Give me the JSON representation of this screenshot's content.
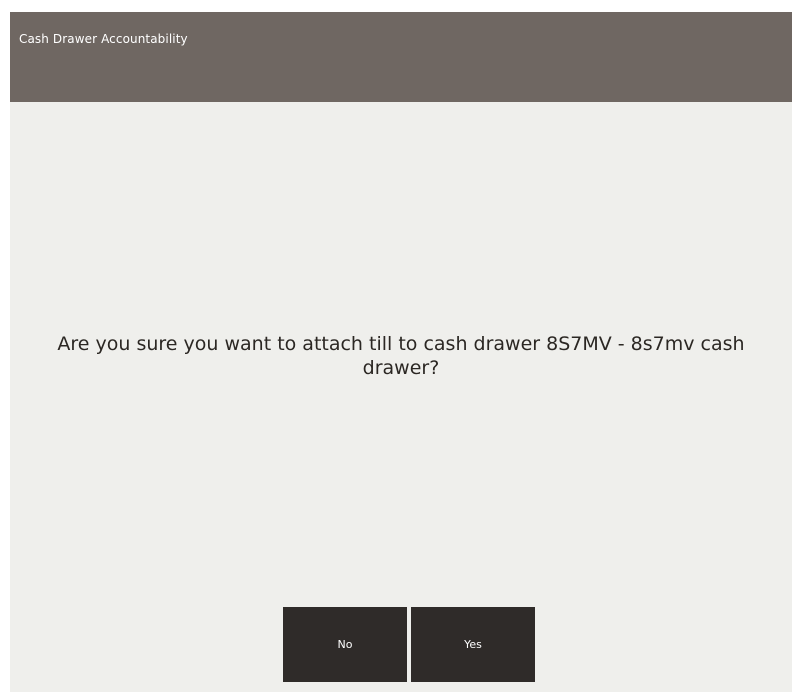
{
  "header": {
    "title": "Cash Drawer Accountability"
  },
  "dialog": {
    "message": "Are you sure you want to attach till to cash drawer 8S7MV - 8s7mv cash drawer?"
  },
  "buttons": {
    "no_label": "No",
    "yes_label": "Yes"
  },
  "colors": {
    "header_bg": "#6f6762",
    "panel_bg": "#efefec",
    "button_bg": "#2f2b29",
    "text": "#2b2723"
  }
}
